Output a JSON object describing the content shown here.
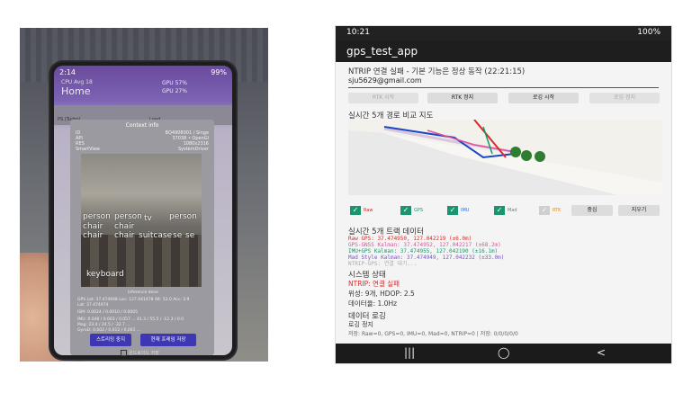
{
  "left_photo": {
    "status": {
      "time": "2:14",
      "battery": "99%"
    },
    "home_label": "Home",
    "cpu_label": "CPU Avg 18",
    "gpu_lines": [
      "GPU 57%",
      "GPU 27%"
    ],
    "top_row": {
      "left": "PS (Turbo)",
      "right": "Load"
    },
    "dialog_title": "Context info",
    "dialog_rows": [
      {
        "k": "ID",
        "v": "BQ4908001 / Singe"
      },
      {
        "k": "API",
        "v": "37038 • OpenGl"
      },
      {
        "k": "RES",
        "v": "1080x2316"
      },
      {
        "k": "SmartView",
        "v": "SystemDriver"
      }
    ],
    "detections": [
      {
        "text": "person"
      },
      {
        "text": "person"
      },
      {
        "text": "tv"
      },
      {
        "text": "person"
      },
      {
        "text": "chair"
      },
      {
        "text": "chair"
      },
      {
        "text": "chair"
      },
      {
        "text": "chair"
      },
      {
        "text": "suitcase"
      },
      {
        "text": "se"
      },
      {
        "text": "se"
      },
      {
        "text": "keyboard"
      }
    ],
    "inference": "Inference done",
    "info_lines": [
      "GPS Lat: 37.474948 Lon: 127.041478 Alt: 52.0 Acc: 3.9",
      "Lat: 37.474974",
      "ISM: 0.0024 / 0.0010 / 0.0005",
      "IMU: 0.048 / 0.003 / 0.057 ... 41.3 / 55.5 / -12.3 / 0.0",
      "Mag: 23.4 / 24.5 / -32.7 ...",
      "GyroD: 0.002 / 0.012 / 0.001 ..."
    ],
    "buttons": [
      "스트리밍 중지",
      "현재 프레임 저장"
    ],
    "checkbox_label": "원드로이드 저장"
  },
  "right": {
    "status": {
      "time": "10:21",
      "battery": "100%"
    },
    "app_title": "gps_test_app",
    "ntrip_status": "NTRIP 연결 실패 - 기본 기능은 정상 동작 (22:21:15)",
    "email": "sju5629@gmail.com",
    "buttons": [
      {
        "label": "RTK 시작",
        "enabled": false
      },
      {
        "label": "RTK 정지",
        "enabled": true
      },
      {
        "label": "로깅 시작",
        "enabled": true
      },
      {
        "label": "로깅 정지",
        "enabled": false
      }
    ],
    "map_title": "실시간 5개 경로 비교 지도",
    "legend": [
      {
        "label": "Raw",
        "color": "#d62b2b"
      },
      {
        "label": "GPS",
        "color": "#1c9470"
      },
      {
        "label": "IMU",
        "color": "#2f6bd6"
      },
      {
        "label": "Mad",
        "color": "#7a7a7a"
      },
      {
        "label": "RTK",
        "color": "#e08a2b"
      }
    ],
    "center_button": "중심",
    "clear_button": "지우기",
    "data_title": "실시간 5개 트랙 데이터",
    "data_lines": [
      {
        "text": "Raw GPS: 37.474950, 127.042219 (±6.0m)",
        "color": "#d62b2b"
      },
      {
        "text": "GPS-GNSS Kalman: 37.474952, 127.042217 (±68.2m)",
        "color": "#e0529a"
      },
      {
        "text": "IMU+GPS Kalman: 37.474955, 127.042190 (±16.1m)",
        "color": "#1c9470"
      },
      {
        "text": "Mad Style Kalman: 37.474949, 127.042232 (±33.0m)",
        "color": "#7a55c5"
      },
      {
        "text": "NTRIP-GPS: 연결 대기...",
        "color": "#aaaaaa"
      }
    ],
    "sys_title": "시스템 상태",
    "sys_ntrip": "NTRIP: 연결 실패",
    "sys_sats": "위성: 9개, HDOP: 2.5",
    "sys_rate": "데이터율: 1.0Hz",
    "log_title": "데이터 로깅",
    "log_status": "로깅 정지",
    "log_counts": "저장: Raw=0, GPS=0, IMU=0, Mad=0, NTRIP=0 | 저장: 0/0/0/0/0"
  },
  "icons": {
    "nav_recent": "|||",
    "nav_home": "◯",
    "nav_back": "<"
  }
}
